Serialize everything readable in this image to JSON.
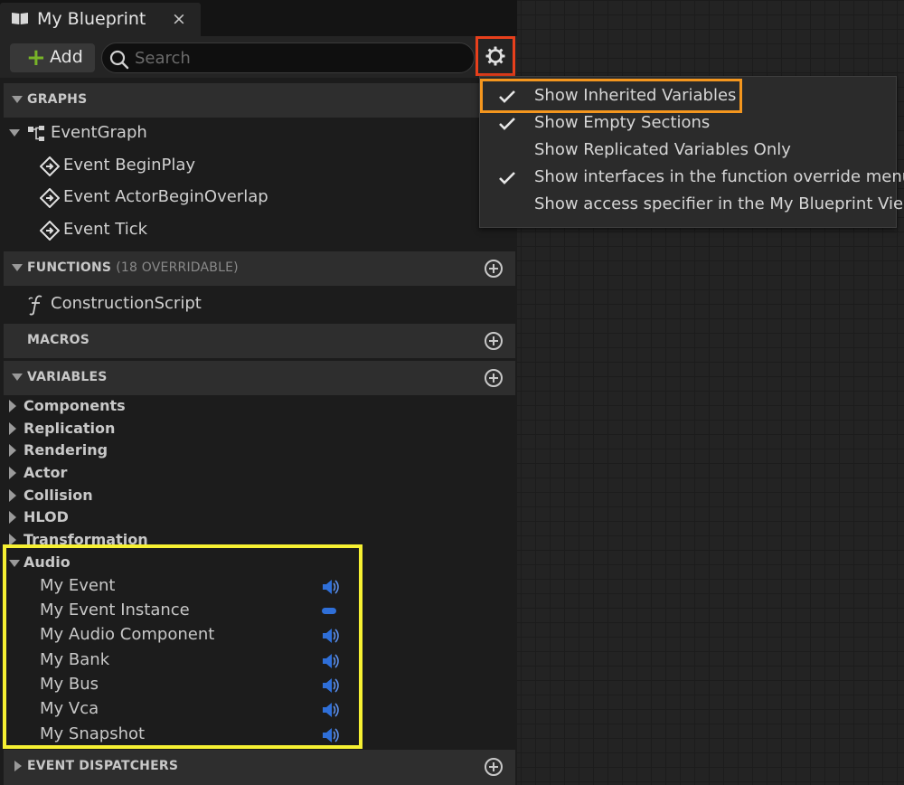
{
  "tab": {
    "title": "My Blueprint",
    "close": "×"
  },
  "toolbar": {
    "add_label": "Add",
    "search_placeholder": "Search"
  },
  "sections": {
    "graphs": "GRAPHS",
    "functions": "FUNCTIONS",
    "functions_sub": "(18 OVERRIDABLE)",
    "macros": "MACROS",
    "variables": "VARIABLES",
    "event_dispatchers": "EVENT DISPATCHERS"
  },
  "graphs": {
    "event_graph": "EventGraph",
    "events": [
      "Event BeginPlay",
      "Event ActorBeginOverlap",
      "Event Tick"
    ]
  },
  "functions": {
    "items": [
      "ConstructionScript"
    ]
  },
  "variables": {
    "categories": [
      "Components",
      "Replication",
      "Rendering",
      "Actor",
      "Collision",
      "HLOD",
      "Transformation"
    ],
    "audio_category": "Audio",
    "audio_items": [
      "My Event",
      "My Event Instance",
      "My Audio Component",
      "My Bank",
      "My Bus",
      "My Vca",
      "My Snapshot"
    ]
  },
  "menu": {
    "items": [
      {
        "label": "Show Inherited Variables",
        "checked": true
      },
      {
        "label": "Show Empty Sections",
        "checked": true
      },
      {
        "label": "Show Replicated Variables Only",
        "checked": false
      },
      {
        "label": "Show interfaces in the function override menu",
        "checked": true
      },
      {
        "label": "Show access specifier in the My Blueprint View",
        "checked": false
      }
    ]
  },
  "colors": {
    "add_plus": "#78b428",
    "audio_badge": "#2f6fd8",
    "highlight_gear": "#e8401c",
    "highlight_menu": "#f4961e",
    "highlight_audio": "#f6f032"
  }
}
